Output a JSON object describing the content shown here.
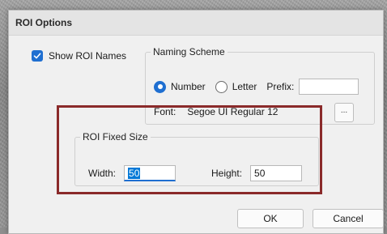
{
  "dialog": {
    "title": "ROI Options"
  },
  "show_names": {
    "label": "Show ROI Names",
    "checked": true
  },
  "naming_scheme": {
    "legend": "Naming Scheme",
    "options": [
      {
        "label": "Number",
        "selected": true
      },
      {
        "label": "Letter",
        "selected": false
      }
    ],
    "prefix_label": "Prefix:",
    "prefix_value": "",
    "font_label": "Font:",
    "font_value": "Segoe UI Regular 12",
    "font_button_label": "..."
  },
  "fixed_size": {
    "legend": "ROI Fixed Size",
    "width_label": "Width:",
    "width_value": "50",
    "height_label": "Height:",
    "height_value": "50"
  },
  "buttons": {
    "ok_label": "OK",
    "cancel_label": "Cancel"
  },
  "colors": {
    "accent": "#1f6fd1",
    "highlight_frame": "#8a2a2a",
    "selection": "#0078d7"
  }
}
